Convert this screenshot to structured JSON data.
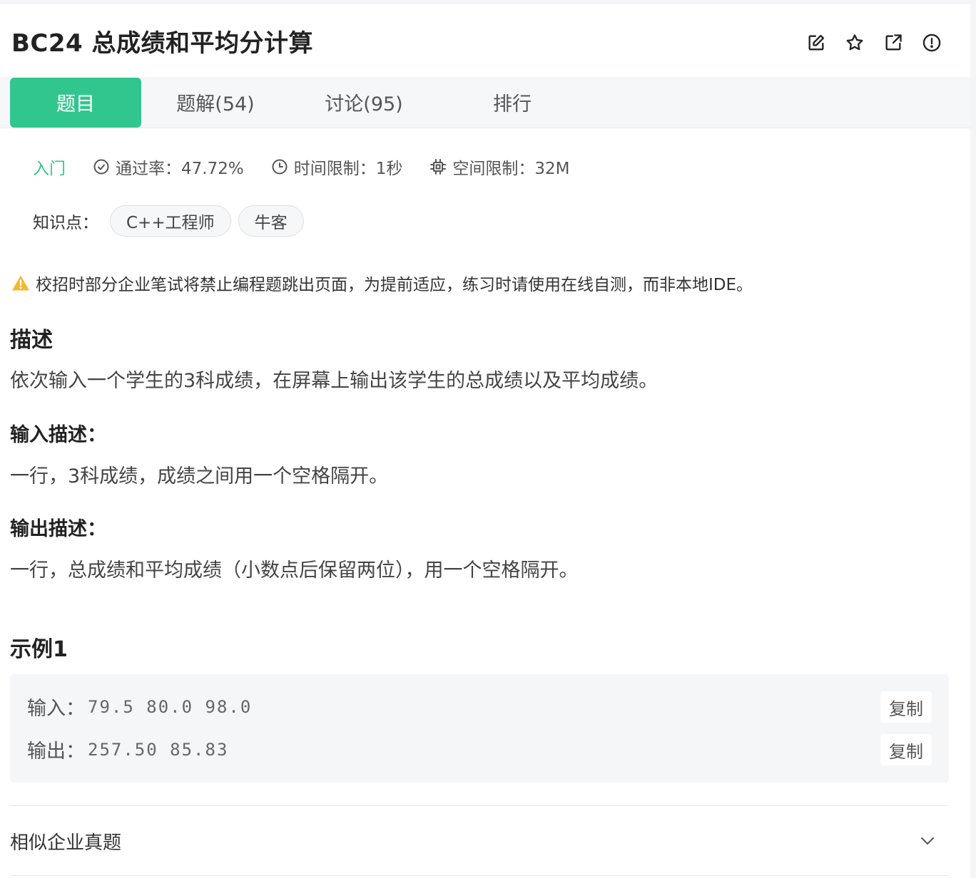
{
  "header": {
    "title": "BC24  总成绩和平均分计算",
    "actions": [
      {
        "icon": "edit-icon"
      },
      {
        "icon": "star-icon"
      },
      {
        "icon": "share-icon"
      },
      {
        "icon": "report-icon"
      }
    ]
  },
  "tabs": [
    {
      "label": "题目",
      "active": true
    },
    {
      "label": "题解(54)"
    },
    {
      "label": "讨论(95)"
    },
    {
      "label": "排行"
    }
  ],
  "meta": {
    "level": "入门",
    "pass_rate": "通过率：47.72%",
    "time_limit": "时间限制：1秒",
    "memory_limit": "空间限制：32M"
  },
  "tags": {
    "label": "知识点：",
    "items": [
      "C++工程师",
      "牛客"
    ]
  },
  "warning": "校招时部分企业笔试将禁止编程题跳出页面，为提前适应，练习时请使用在线自测，而非本地IDE。",
  "description": {
    "heading": "描述",
    "text": "依次输入一个学生的3科成绩，在屏幕上输出该学生的总成绩以及平均成绩。"
  },
  "input_desc": {
    "heading": "输入描述：",
    "text": "一行，3科成绩，成绩之间用一个空格隔开。"
  },
  "output_desc": {
    "heading": "输出描述：",
    "text": "一行，总成绩和平均成绩（小数点后保留两位），用一个空格隔开。"
  },
  "example": {
    "heading": "示例1",
    "input_label": "输入：",
    "input_value": "79.5 80.0 98.0",
    "output_label": "输出：",
    "output_value": "257.50 85.83",
    "copy_label": "复制"
  },
  "similar": {
    "label": "相似企业真题"
  },
  "colors": {
    "accent": "#32c68f",
    "warning": "#f5b82e"
  }
}
